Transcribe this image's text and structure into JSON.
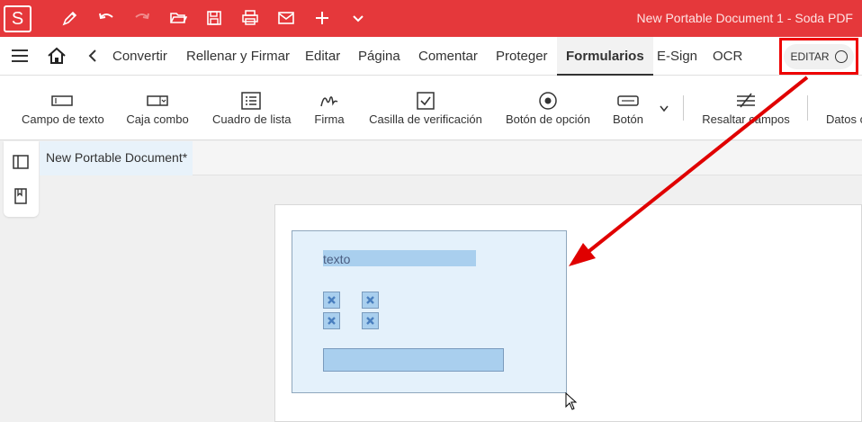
{
  "app": {
    "logo_letter": "S",
    "window_title": "New Portable Document 1   -   Soda PDF"
  },
  "titlebar_icons": [
    "pen-icon",
    "undo-icon",
    "redo-icon",
    "folder-open-icon",
    "save-icon",
    "print-icon",
    "mail-icon",
    "plus-icon",
    "chevron-down-icon"
  ],
  "menu": {
    "items": [
      "Convertir",
      "Rellenar y Firmar",
      "Editar",
      "Página",
      "Comentar",
      "Proteger",
      "Formularios",
      "E-Sign",
      "OCR"
    ],
    "active": "Formularios",
    "editar_label": "EDITAR"
  },
  "ribbon": {
    "buttons": [
      {
        "label": "Campo de texto",
        "icon": "text-field-icon"
      },
      {
        "label": "Caja combo",
        "icon": "combo-box-icon"
      },
      {
        "label": "Cuadro de lista",
        "icon": "list-box-icon"
      },
      {
        "label": "Firma",
        "icon": "signature-icon"
      },
      {
        "label": "Casilla de verificación",
        "icon": "checkbox-icon"
      },
      {
        "label": "Botón de opción",
        "icon": "radio-button-icon"
      },
      {
        "label": "Botón",
        "icon": "button-icon"
      },
      {
        "label": "Resaltar campos",
        "icon": "highlight-fields-icon"
      },
      {
        "label": "Datos c",
        "icon": "data-icon"
      }
    ]
  },
  "document": {
    "tab_label": "New Portable Document*",
    "text_field_value": "texto"
  },
  "colors": {
    "titlebar": "#e5383b",
    "annotation": "#e00000",
    "form_fill": "#a9cfee"
  }
}
